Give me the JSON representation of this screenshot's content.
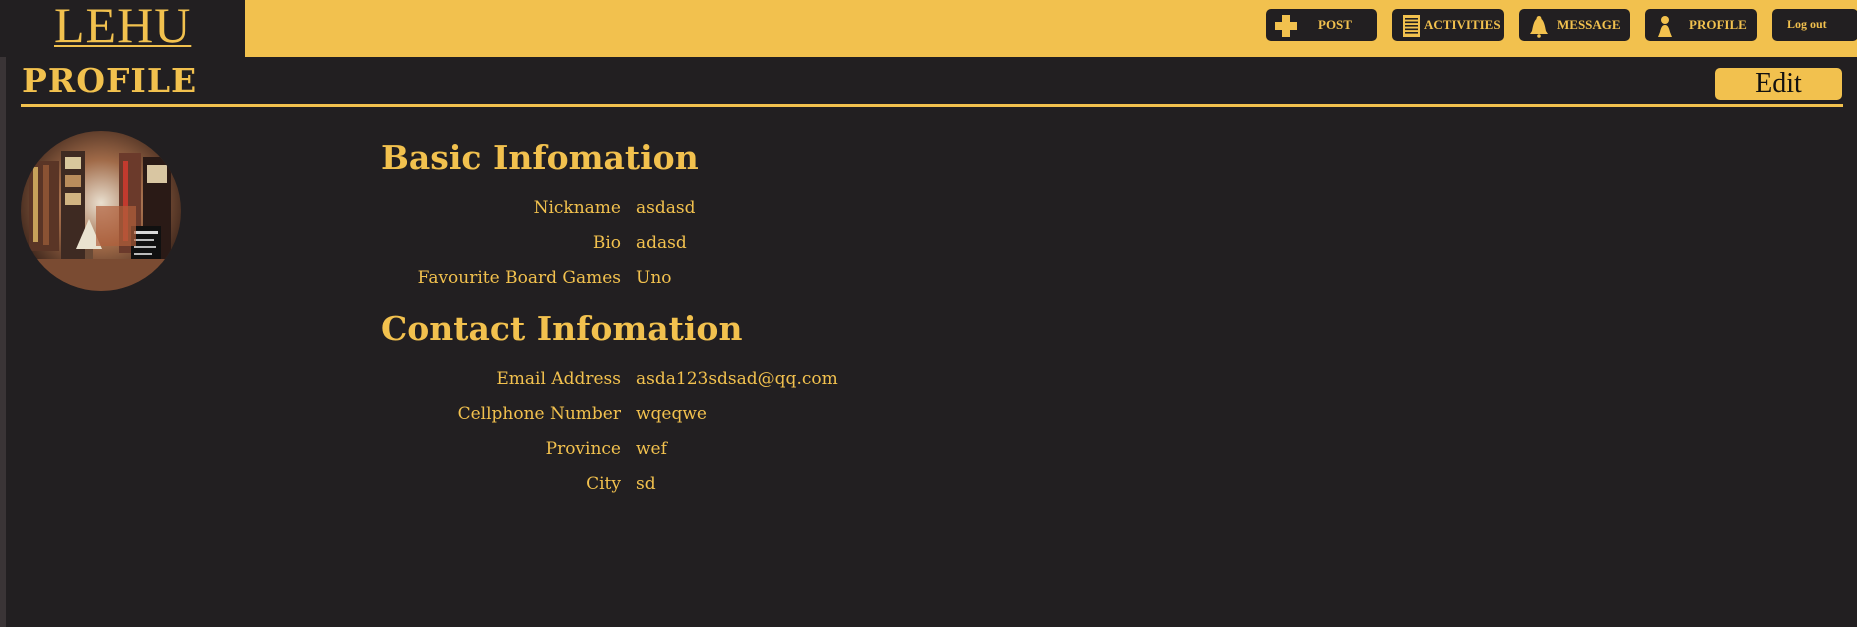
{
  "header": {
    "logo": "LEHU",
    "nav": [
      {
        "id": "post",
        "label": "POST",
        "icon": "plus-icon"
      },
      {
        "id": "activities",
        "label": "ACTIVITIES",
        "icon": "document-icon"
      },
      {
        "id": "message",
        "label": "MESSAGE",
        "icon": "bell-icon"
      },
      {
        "id": "profile",
        "label": "PROFILE",
        "icon": "person-icon"
      }
    ],
    "logout_label": "Log out"
  },
  "page": {
    "title": "PROFILE",
    "edit_label": "Edit"
  },
  "basic": {
    "title": "Basic Infomation",
    "fields": [
      {
        "label": "Nickname",
        "value": "asdasd"
      },
      {
        "label": "Bio",
        "value": "adasd"
      },
      {
        "label": "Favourite Board Games",
        "value": "Uno"
      }
    ]
  },
  "contact": {
    "title": "Contact Infomation",
    "fields": [
      {
        "label": "Email Address",
        "value": "asda123sdsad@qq.com"
      },
      {
        "label": "Cellphone Number",
        "value": "wqeqwe"
      },
      {
        "label": "Province",
        "value": "wef"
      },
      {
        "label": "City",
        "value": "sd"
      }
    ]
  },
  "colors": {
    "accent": "#f2c14e",
    "background": "#221f21"
  }
}
